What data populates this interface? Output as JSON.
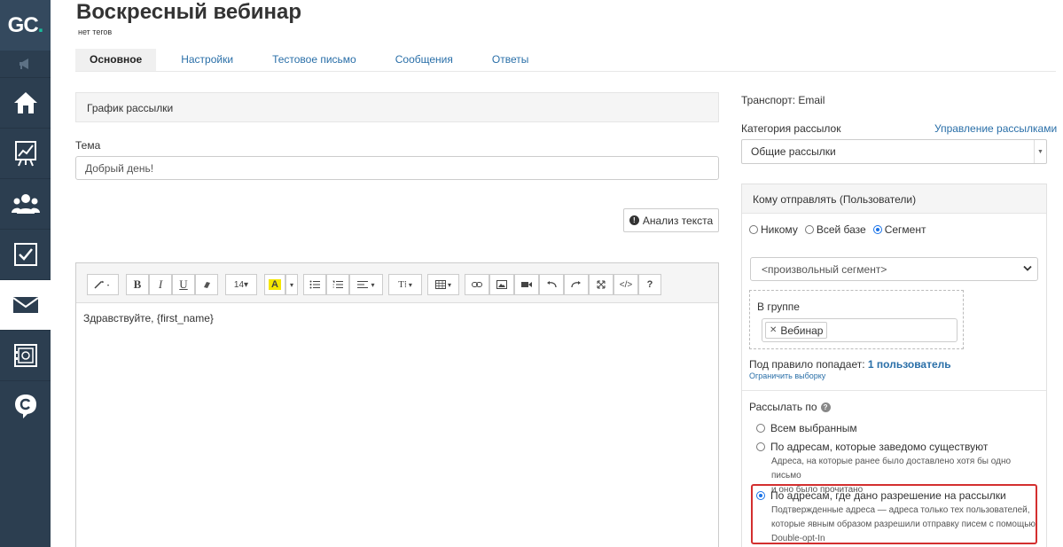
{
  "sidebar": {
    "logo_main": "GC",
    "logo_dot": ".",
    "items": [
      {
        "name": "home-icon"
      },
      {
        "name": "chart-icon"
      },
      {
        "name": "users-icon"
      },
      {
        "name": "checkbox-icon"
      },
      {
        "name": "mail-icon",
        "active": true
      },
      {
        "name": "safe-icon"
      },
      {
        "name": "chat-icon"
      }
    ]
  },
  "header": {
    "title": "Воскресный вебинар",
    "tags": "нет тегов"
  },
  "tabs": [
    {
      "label": "Основное",
      "active": true
    },
    {
      "label": "Настройки"
    },
    {
      "label": "Тестовое письмо"
    },
    {
      "label": "Сообщения"
    },
    {
      "label": "Ответы"
    }
  ],
  "main": {
    "schedule_title": "График рассылки",
    "subject_label": "Тема",
    "subject_value": "Добрый день!",
    "analyze_button": "Анализ текста",
    "editor_content": "Здравствуйте, {first_name}",
    "toolbar": {
      "font_size": "14",
      "highlight_letter": "A",
      "bold": "B",
      "italic": "I",
      "underline": "U",
      "help": "?"
    }
  },
  "right": {
    "transport": "Транспорт: Email",
    "category_label": "Категория рассылок",
    "manage_link": "Управление рассылками",
    "category_value": "Общие рассылки",
    "recipients_title": "Кому отправлять (Пользователи)",
    "radio_options": [
      {
        "label": "Никому",
        "checked": false
      },
      {
        "label": "Всей базе",
        "checked": false
      },
      {
        "label": "Сегмент",
        "checked": true
      }
    ],
    "segment_value": "<произвольный сегмент>",
    "group_label": "В группе",
    "group_tag": "Вебинар",
    "rule_prefix": "Под правило попадает:",
    "rule_count": "1 пользователь",
    "limit_link": "Ограничить выборку",
    "send_by_label": "Рассылать по",
    "send_options": [
      {
        "label": "Всем выбранным",
        "checked": false,
        "desc": []
      },
      {
        "label": "По адресам, которые заведомо существуют",
        "checked": false,
        "desc": [
          "Адреса, на которые ранее было доставлено хотя бы одно письмо",
          "и оно было прочитано"
        ]
      },
      {
        "label": "По адресам, где дано разрешение на рассылки",
        "checked": true,
        "desc": [
          "Подтвержденные адреса — адреса только тех пользователей,",
          "которые явным образом разрешили отправку писем с помощью",
          "Double-opt-In"
        ]
      }
    ],
    "accent_color": "#d32f2f"
  }
}
